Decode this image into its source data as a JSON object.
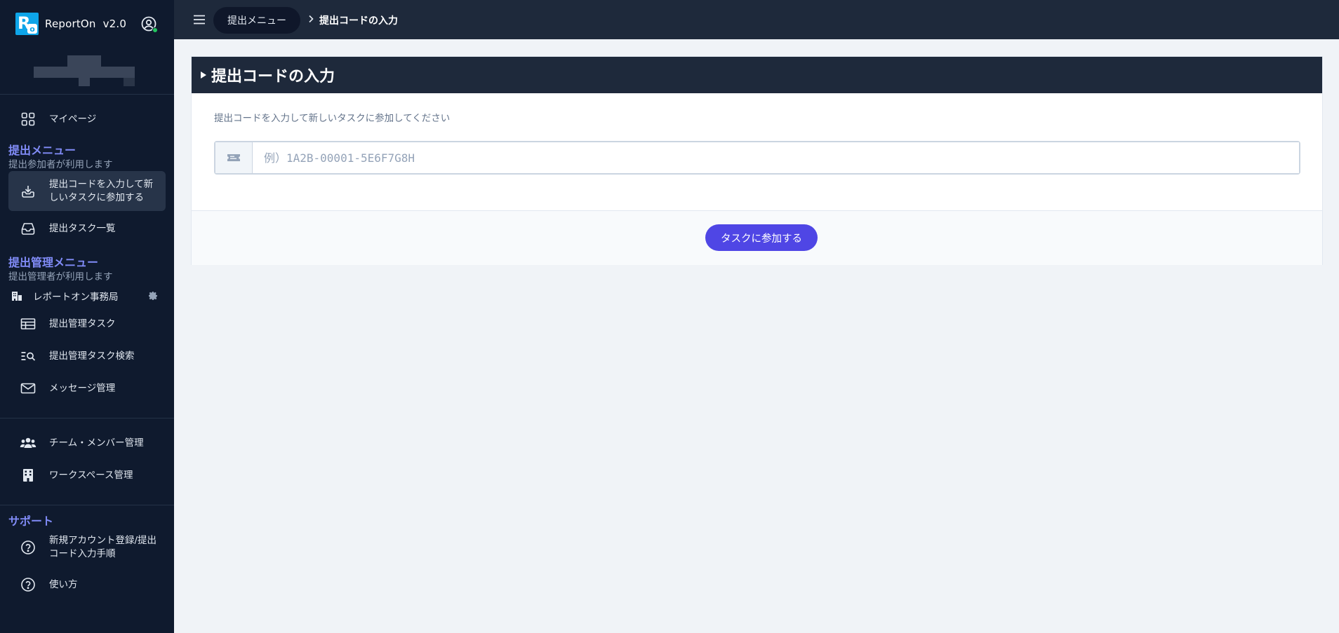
{
  "app": {
    "name": "ReportOn",
    "version": "v2.0"
  },
  "sidebar": {
    "mypage": "マイページ",
    "submit_section": {
      "title": "提出メニュー",
      "subtitle": "提出参加者が利用します",
      "items": [
        "提出コードを入力して新しいタスクに参加する",
        "提出タスク一覧"
      ]
    },
    "admin_section": {
      "title": "提出管理メニュー",
      "subtitle": "提出管理者が利用します",
      "org": "レポートオン事務局",
      "items": [
        "提出管理タスク",
        "提出管理タスク検索",
        "メッセージ管理"
      ]
    },
    "management_items": [
      "チーム・メンバー管理",
      "ワークスペース管理"
    ],
    "support_section": {
      "title": "サポート",
      "items": [
        "新規アカウント登録/提出コード入力手順",
        "使い方"
      ]
    }
  },
  "topbar": {
    "breadcrumb_parent": "提出メニュー",
    "breadcrumb_current": "提出コードの入力"
  },
  "card": {
    "title": "提出コードの入力",
    "description": "提出コードを入力して新しいタスクに参加してください",
    "input_placeholder": "例）1A2B-00001-5E6F7G8H",
    "input_value": "",
    "submit_label": "タスクに参加する"
  },
  "colors": {
    "accent": "#4f46e5",
    "section_title": "#818cf8",
    "sidebar_bg": "#0f1a2e",
    "header_bg": "#1e293b"
  }
}
